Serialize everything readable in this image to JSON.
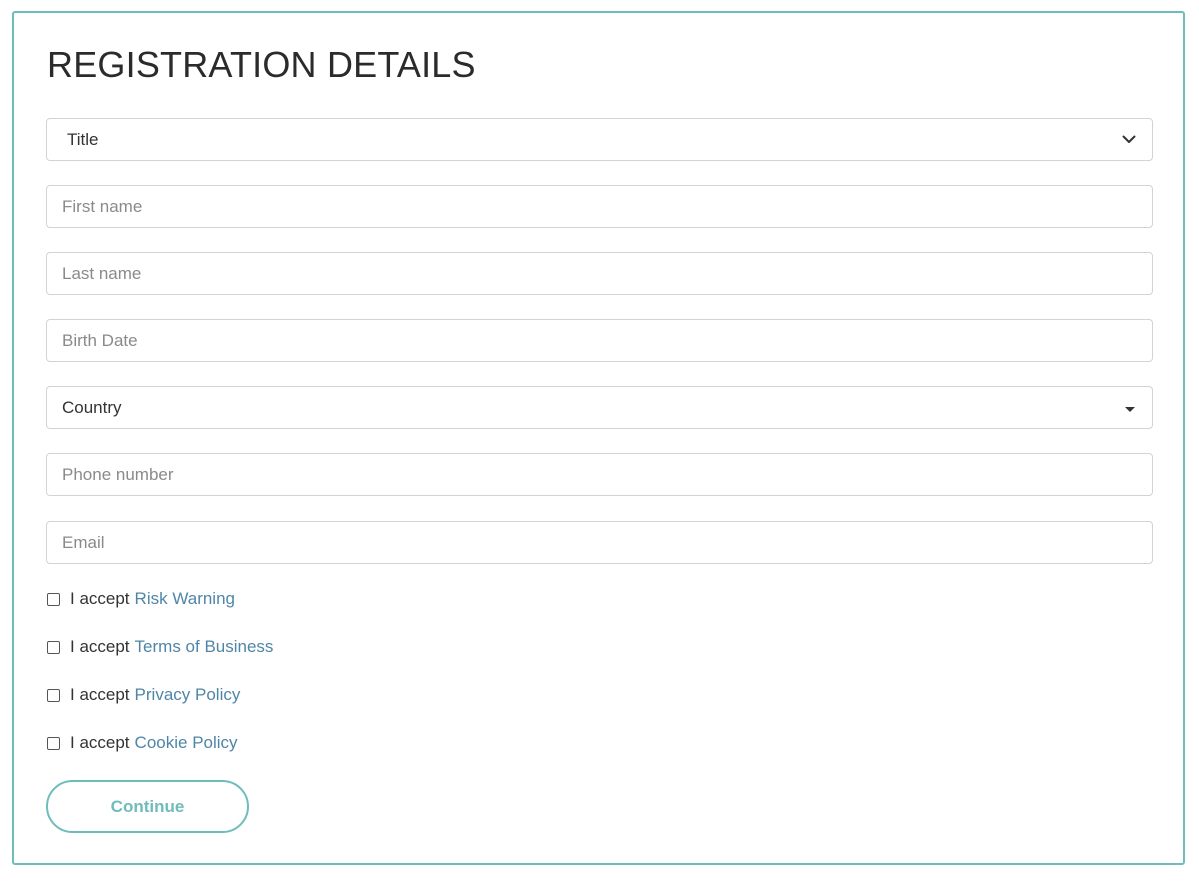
{
  "form": {
    "heading": "REGISTRATION DETAILS",
    "title_select": {
      "value": "Title",
      "icon": "chevron-down-icon"
    },
    "first_name": {
      "placeholder": "First name",
      "value": ""
    },
    "last_name": {
      "placeholder": "Last name",
      "value": ""
    },
    "birth_date": {
      "placeholder": "Birth Date",
      "value": ""
    },
    "country_select": {
      "value": "Country",
      "icon": "caret-down-icon"
    },
    "phone": {
      "placeholder": "Phone number",
      "value": ""
    },
    "email": {
      "placeholder": "Email",
      "value": ""
    },
    "agreements": [
      {
        "prefix": "I accept",
        "link": "Risk Warning",
        "checked": false
      },
      {
        "prefix": "I accept",
        "link": "Terms of Business",
        "checked": false
      },
      {
        "prefix": "I accept",
        "link": "Privacy Policy",
        "checked": false
      },
      {
        "prefix": "I accept",
        "link": "Cookie Policy",
        "checked": false
      }
    ],
    "continue_label": "Continue"
  },
  "colors": {
    "accent": "#6fbcbc",
    "link": "#4f86a7",
    "text": "#333333",
    "border": "#cfd4d8"
  }
}
